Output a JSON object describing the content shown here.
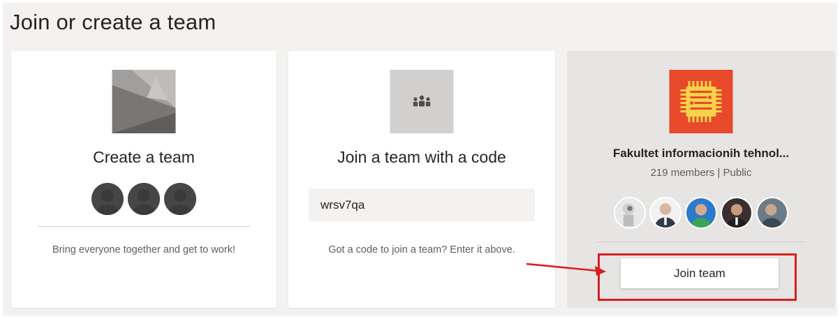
{
  "page": {
    "title": "Join or create a team"
  },
  "create_card": {
    "title": "Create a team",
    "description": "Bring everyone together and get to work!"
  },
  "join_code_card": {
    "title": "Join a team with a code",
    "code_value": "wrsv7qa",
    "description": "Got a code to join a team? Enter it above."
  },
  "team_card": {
    "name": "Fakultet informacionih tehnol...",
    "meta": "219 members | Public",
    "join_label": "Join team",
    "logo_color": "#e8492a"
  },
  "annotations": {
    "highlight_color": "#d81e1e"
  },
  "icons": {
    "create": "team-placeholder-image-icon",
    "code": "people-group-icon",
    "team_logo": "circuit-chip-icon"
  }
}
